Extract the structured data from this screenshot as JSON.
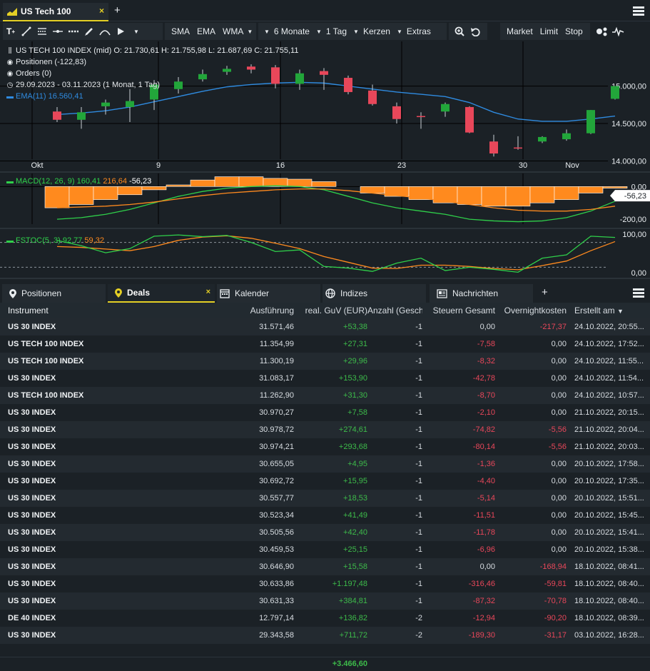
{
  "tab": {
    "title": "US Tech 100",
    "close": "×",
    "add": "+"
  },
  "toolbar": {
    "indicators": [
      "SMA",
      "EMA",
      "WMA"
    ],
    "period": "6 Monate",
    "interval": "1 Tag",
    "chart_type": "Kerzen",
    "extras": "Extras",
    "orders": [
      "Market",
      "Limit",
      "Stop"
    ]
  },
  "legend": {
    "ohlc": "US TECH 100 INDEX (mid)  O: 21.730,61  H: 21.755,98  L: 21.687,69  C: 21.755,11",
    "positions": "Positionen (-122,83)",
    "orders": "Orders (0)",
    "range": "29.09.2023 - 03.11.2023   (1 Monat, 1 Tag)",
    "ema": "EMA(11)  16.560,41",
    "macd_name": "MACD(12, 26, 9)",
    "macd_v1": "160,41",
    "macd_v2": "216,64",
    "macd_v3": "-56,23",
    "fstoc_name": "FSTOC(5, 3)",
    "fstoc_v1": "92,77",
    "fstoc_v2": "59,32"
  },
  "chart_data": {
    "type": "candlestick",
    "x_ticks": [
      "Okt",
      "9",
      "16",
      "23",
      "30",
      "Nov"
    ],
    "y_ticks": [
      "15.000,00",
      "14.500,00",
      "14.000,00"
    ],
    "ylim": [
      13900,
      15520
    ],
    "candles": [
      {
        "o": 14660,
        "h": 14720,
        "l": 14520,
        "c": 14550
      },
      {
        "o": 14550,
        "h": 14720,
        "l": 14430,
        "c": 14650
      },
      {
        "o": 14730,
        "h": 14820,
        "l": 14620,
        "c": 14780
      },
      {
        "o": 14720,
        "h": 14960,
        "l": 14520,
        "c": 14800
      },
      {
        "o": 14820,
        "h": 15080,
        "l": 14680,
        "c": 15020
      },
      {
        "o": 14960,
        "h": 15120,
        "l": 14900,
        "c": 15060
      },
      {
        "o": 15090,
        "h": 15220,
        "l": 15060,
        "c": 15160
      },
      {
        "o": 15190,
        "h": 15270,
        "l": 15150,
        "c": 15230
      },
      {
        "o": 15260,
        "h": 15290,
        "l": 15170,
        "c": 15220
      },
      {
        "o": 15250,
        "h": 15280,
        "l": 14970,
        "c": 15030
      },
      {
        "o": 15030,
        "h": 15220,
        "l": 14950,
        "c": 15170
      },
      {
        "o": 15200,
        "h": 15240,
        "l": 14950,
        "c": 15150
      },
      {
        "o": 15110,
        "h": 15140,
        "l": 14890,
        "c": 14920
      },
      {
        "o": 14940,
        "h": 15020,
        "l": 14740,
        "c": 14760
      },
      {
        "o": 14730,
        "h": 14780,
        "l": 14500,
        "c": 14560
      },
      {
        "o": 14600,
        "h": 14650,
        "l": 14430,
        "c": 14590
      },
      {
        "o": 14660,
        "h": 14780,
        "l": 14590,
        "c": 14760
      },
      {
        "o": 14720,
        "h": 14730,
        "l": 14370,
        "c": 14380
      },
      {
        "o": 14260,
        "h": 14350,
        "l": 14060,
        "c": 14100
      },
      {
        "o": 14180,
        "h": 14330,
        "l": 14150,
        "c": 14170
      },
      {
        "o": 14260,
        "h": 14330,
        "l": 14240,
        "c": 14320
      },
      {
        "o": 14290,
        "h": 14420,
        "l": 14270,
        "c": 14370
      },
      {
        "o": 14370,
        "h": 14680,
        "l": 14360,
        "c": 14680
      },
      {
        "o": 14830,
        "h": 15000,
        "l": 14820,
        "c": 15000
      }
    ],
    "ema": [
      14620,
      14640,
      14670,
      14720,
      14790,
      14860,
      14930,
      14990,
      15020,
      15040,
      15050,
      15040,
      15000,
      14960,
      14920,
      14890,
      14860,
      14780,
      14650,
      14560,
      14530,
      14530,
      14560,
      14600
    ],
    "macd": {
      "y_ticks": [
        "0,00",
        "-200,00"
      ],
      "ylim": [
        -230,
        80
      ],
      "hist": [
        -130,
        -110,
        -80,
        -50,
        -20,
        10,
        40,
        60,
        60,
        50,
        45,
        30,
        0,
        -40,
        -60,
        -80,
        -100,
        -110,
        -120,
        -120,
        -100,
        -80,
        -40,
        -10
      ],
      "macd": [
        -200,
        -190,
        -170,
        -140,
        -100,
        -60,
        -30,
        -10,
        0,
        5,
        0,
        -20,
        -60,
        -100,
        -130,
        -150,
        -170,
        -200,
        -210,
        -215,
        -210,
        -190,
        -150,
        -90
      ],
      "signal": [
        -130,
        -125,
        -120,
        -110,
        -95,
        -75,
        -55,
        -40,
        -30,
        -20,
        -15,
        -15,
        -25,
        -40,
        -55,
        -70,
        -90,
        -110,
        -130,
        -145,
        -150,
        -150,
        -140,
        -120
      ],
      "badge": "-56,23"
    },
    "fstoc": {
      "y_ticks": [
        "100,00",
        "0,00"
      ],
      "ylim": [
        0,
        100
      ],
      "k": [
        85,
        72,
        55,
        65,
        95,
        98,
        94,
        97,
        80,
        58,
        62,
        22,
        18,
        10,
        30,
        42,
        12,
        20,
        15,
        8,
        42,
        50,
        95,
        92
      ],
      "d": [
        70,
        68,
        64,
        60,
        70,
        85,
        93,
        96,
        90,
        78,
        65,
        46,
        32,
        18,
        17,
        25,
        25,
        22,
        17,
        14,
        24,
        35,
        60,
        82
      ]
    }
  },
  "bottom_tabs": {
    "positions": "Positionen",
    "deals": "Deals",
    "calendar": "Kalender",
    "indices": "Indizes",
    "news": "Nachrichten",
    "close": "×",
    "add": "+"
  },
  "table": {
    "headers": {
      "instrument": "Instrument",
      "execution": "Ausführung",
      "pl": "real. GuV (EUR)",
      "qty": "Anzahl (Geschl",
      "tax": "Steuern Gesamt",
      "overnight": "Overnightkosten",
      "created": "Erstellt am"
    },
    "rows": [
      [
        "US 30 INDEX",
        "31.571,46",
        "+53,38",
        "-1",
        "0,00",
        "-217,37",
        "24.10.2022, 20:55..."
      ],
      [
        "US TECH 100 INDEX",
        "11.354,99",
        "+27,31",
        "-1",
        "-7,58",
        "0,00",
        "24.10.2022, 17:52..."
      ],
      [
        "US TECH 100 INDEX",
        "11.300,19",
        "+29,96",
        "-1",
        "-8,32",
        "0,00",
        "24.10.2022, 11:55..."
      ],
      [
        "US 30 INDEX",
        "31.083,17",
        "+153,90",
        "-1",
        "-42,78",
        "0,00",
        "24.10.2022, 11:54..."
      ],
      [
        "US TECH 100 INDEX",
        "11.262,90",
        "+31,30",
        "-1",
        "-8,70",
        "0,00",
        "24.10.2022, 10:57..."
      ],
      [
        "US 30 INDEX",
        "30.970,27",
        "+7,58",
        "-1",
        "-2,10",
        "0,00",
        "21.10.2022, 20:15..."
      ],
      [
        "US 30 INDEX",
        "30.978,72",
        "+274,61",
        "-1",
        "-74,82",
        "-5,56",
        "21.10.2022, 20:04..."
      ],
      [
        "US 30 INDEX",
        "30.974,21",
        "+293,68",
        "-1",
        "-80,14",
        "-5,56",
        "21.10.2022, 20:03..."
      ],
      [
        "US 30 INDEX",
        "30.655,05",
        "+4,95",
        "-1",
        "-1,36",
        "0,00",
        "20.10.2022, 17:58..."
      ],
      [
        "US 30 INDEX",
        "30.692,72",
        "+15,95",
        "-1",
        "-4,40",
        "0,00",
        "20.10.2022, 17:35..."
      ],
      [
        "US 30 INDEX",
        "30.557,77",
        "+18,53",
        "-1",
        "-5,14",
        "0,00",
        "20.10.2022, 15:51..."
      ],
      [
        "US 30 INDEX",
        "30.523,34",
        "+41,49",
        "-1",
        "-11,51",
        "0,00",
        "20.10.2022, 15:45..."
      ],
      [
        "US 30 INDEX",
        "30.505,56",
        "+42,40",
        "-1",
        "-11,78",
        "0,00",
        "20.10.2022, 15:41..."
      ],
      [
        "US 30 INDEX",
        "30.459,53",
        "+25,15",
        "-1",
        "-6,96",
        "0,00",
        "20.10.2022, 15:38..."
      ],
      [
        "US 30 INDEX",
        "30.646,90",
        "+15,58",
        "-1",
        "0,00",
        "-168,94",
        "18.10.2022, 08:41..."
      ],
      [
        "US 30 INDEX",
        "30.633,86",
        "+1.197,48",
        "-1",
        "-316,46",
        "-59,81",
        "18.10.2022, 08:40..."
      ],
      [
        "US 30 INDEX",
        "30.631,33",
        "+384,81",
        "-1",
        "-87,32",
        "-70,78",
        "18.10.2022, 08:40..."
      ],
      [
        "DE 40 INDEX",
        "12.797,14",
        "+136,82",
        "-2",
        "-12,94",
        "-90,20",
        "18.10.2022, 08:39..."
      ],
      [
        "US 30 INDEX",
        "29.343,58",
        "+711,72",
        "-2",
        "-189,30",
        "-31,17",
        "03.10.2022, 16:28..."
      ]
    ],
    "total": "+3.466,60"
  },
  "colors": {
    "up": "#22a63a",
    "down": "#e8475a",
    "accent": "#e4cf25",
    "ema": "#2f8be0",
    "macd_hist": "#ff8a1e",
    "signal_orange": "#ff8a1e",
    "line_green": "#2fd04a"
  }
}
